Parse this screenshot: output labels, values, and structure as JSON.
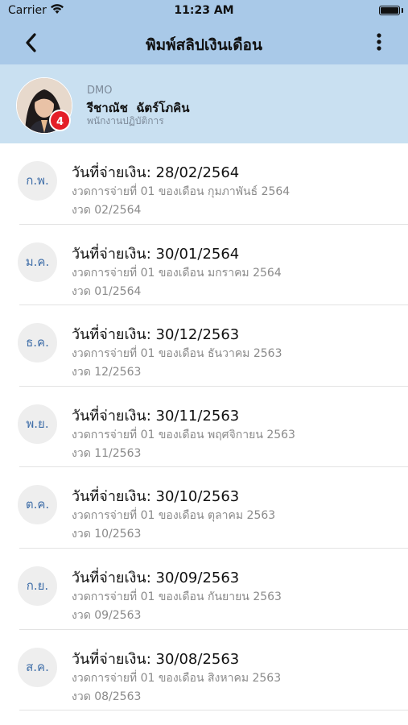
{
  "status_bar": {
    "carrier": "Carrier",
    "time": "11:23 AM"
  },
  "nav": {
    "title": "พิมพ์สลิปเงินเดือน"
  },
  "profile": {
    "company": "DMO",
    "name": "รีชาณัช  ฉัตร์โภคิน",
    "position": "พนักงานปฏิบัติการ",
    "badge_count": "4"
  },
  "colors": {
    "header": "#a9c9e8",
    "profile_bg": "#c9e0f1",
    "badge": "#e41e27",
    "month_text": "#3f6ea8"
  },
  "slips": [
    {
      "month_abbr": "ก.พ.",
      "pay_date": "วันที่จ่ายเงิน: 28/02/2564",
      "description": "งวดการจ่ายที่ 01 ของเดือน กุมภาพันธ์ 2564",
      "period": "งวด 02/2564"
    },
    {
      "month_abbr": "ม.ค.",
      "pay_date": "วันที่จ่ายเงิน: 30/01/2564",
      "description": "งวดการจ่ายที่ 01 ของเดือน มกราคม 2564",
      "period": "งวด 01/2564"
    },
    {
      "month_abbr": "ธ.ค.",
      "pay_date": "วันที่จ่ายเงิน: 30/12/2563",
      "description": "งวดการจ่ายที่ 01 ของเดือน ธันวาคม 2563",
      "period": "งวด 12/2563"
    },
    {
      "month_abbr": "พ.ย.",
      "pay_date": "วันที่จ่ายเงิน: 30/11/2563",
      "description": "งวดการจ่ายที่ 01 ของเดือน พฤศจิกายน 2563",
      "period": "งวด 11/2563"
    },
    {
      "month_abbr": "ต.ค.",
      "pay_date": "วันที่จ่ายเงิน: 30/10/2563",
      "description": "งวดการจ่ายที่ 01 ของเดือน ตุลาคม 2563",
      "period": "งวด 10/2563"
    },
    {
      "month_abbr": "ก.ย.",
      "pay_date": "วันที่จ่ายเงิน: 30/09/2563",
      "description": "งวดการจ่ายที่ 01 ของเดือน กันยายน 2563",
      "period": "งวด 09/2563"
    },
    {
      "month_abbr": "ส.ค.",
      "pay_date": "วันที่จ่ายเงิน: 30/08/2563",
      "description": "งวดการจ่ายที่ 01 ของเดือน สิงหาคม 2563",
      "period": "งวด 08/2563"
    }
  ]
}
